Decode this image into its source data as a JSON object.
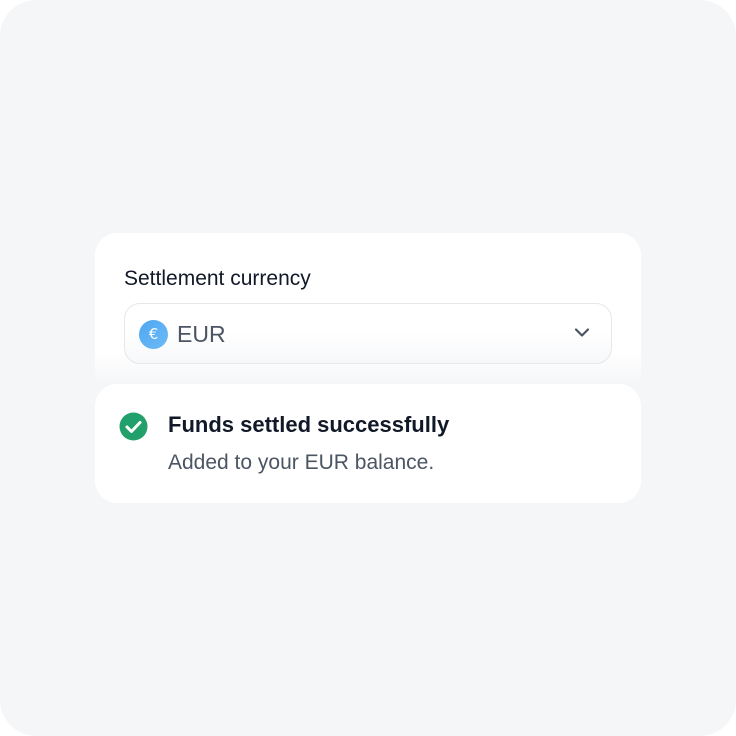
{
  "currency_select": {
    "label": "Settlement currency",
    "selected_value": "EUR",
    "selected_symbol": "€",
    "icon": "euro-icon",
    "dropdown_icon": "chevron-down-icon"
  },
  "notification": {
    "icon": "check-circle-icon",
    "status": "success",
    "title": "Funds settled successfully",
    "message": "Added to your EUR balance."
  },
  "colors": {
    "background": "#f5f6f8",
    "card": "#ffffff",
    "success": "#22a06b",
    "currency_accent": "#4ea6f2",
    "text_primary": "#111827",
    "text_secondary": "#4b5563"
  }
}
